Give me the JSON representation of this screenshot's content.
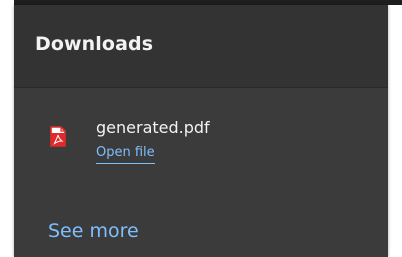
{
  "panel": {
    "title": "Downloads",
    "see_more_label": "See more"
  },
  "downloads": [
    {
      "filename": "generated.pdf",
      "action_label": "Open file",
      "icon": "pdf-file-icon"
    }
  ],
  "colors": {
    "panel_background": "#3b3b3b",
    "header_background": "#333333",
    "text": "#f2f2f2",
    "link": "#7fbfff",
    "pdf_red": "#e02a2a"
  }
}
